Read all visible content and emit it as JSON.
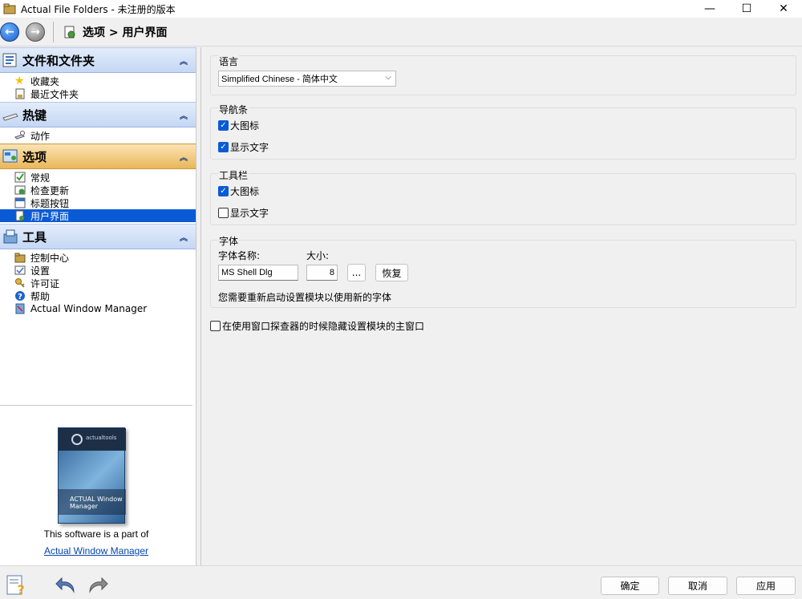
{
  "window": {
    "title": "Actual File Folders - 未注册的版本",
    "minimize_glyph": "—",
    "maximize_glyph": "☐",
    "close_glyph": "✕"
  },
  "nav": {
    "back_glyph": "←",
    "forward_glyph": "→",
    "breadcrumb": "选项 > 用户界面"
  },
  "sidebar": {
    "groups": [
      {
        "label": "文件和文件夹",
        "icon": "folder-list-icon",
        "items": [
          {
            "label": "收藏夹",
            "icon": "star-icon"
          },
          {
            "label": "最近文件夹",
            "icon": "recent-folder-icon"
          }
        ]
      },
      {
        "label": "热键",
        "icon": "keyboard-icon",
        "items": [
          {
            "label": "动作",
            "icon": "action-icon"
          }
        ]
      },
      {
        "label": "选项",
        "icon": "options-icon",
        "items": [
          {
            "label": "常规",
            "icon": "general-icon"
          },
          {
            "label": "检查更新",
            "icon": "update-icon"
          },
          {
            "label": "标题按钮",
            "icon": "title-buttons-icon"
          },
          {
            "label": "用户界面",
            "icon": "user-interface-icon"
          }
        ]
      },
      {
        "label": "工具",
        "icon": "tools-icon",
        "items": [
          {
            "label": "控制中心",
            "icon": "control-center-icon"
          },
          {
            "label": "设置",
            "icon": "settings-icon"
          },
          {
            "label": "许可证",
            "icon": "license-icon"
          },
          {
            "label": "帮助",
            "icon": "help-icon"
          },
          {
            "label": "Actual Window Manager",
            "icon": "awm-icon"
          }
        ]
      }
    ],
    "collapse_glyph": "︽",
    "promo": {
      "box_brand": "actualtools",
      "box_name": "ACTUAL Window Manager",
      "text": "This software is a part of",
      "link": "Actual Window Manager"
    }
  },
  "settings": {
    "language": {
      "legend": "语言",
      "selected": "Simplified Chinese - 简体中文"
    },
    "navbar": {
      "legend": "导航条",
      "large_icons": {
        "label": "大图标",
        "checked": true
      },
      "show_text": {
        "label": "显示文字",
        "checked": true
      }
    },
    "toolbar": {
      "legend": "工具栏",
      "large_icons": {
        "label": "大图标",
        "checked": true
      },
      "show_text": {
        "label": "显示文字",
        "checked": false
      }
    },
    "font": {
      "legend": "字体",
      "name_label": "字体名称:",
      "size_label": "大小:",
      "name_value": "MS Shell Dlg",
      "size_value": "8",
      "browse_label": "...",
      "reset_label": "恢复",
      "note": "您需要重新启动设置模块以使用新的字体"
    },
    "hide_main_window": {
      "label": "在使用窗口探查器的时候隐藏设置模块的主窗口",
      "checked": false
    }
  },
  "footer": {
    "ok": "确定",
    "cancel": "取消",
    "apply": "应用"
  },
  "colors": {
    "selection": "#0a5ad6",
    "group_header": "#c5d7f4",
    "group_header_active": "#e9b759",
    "link": "#0645ad"
  }
}
